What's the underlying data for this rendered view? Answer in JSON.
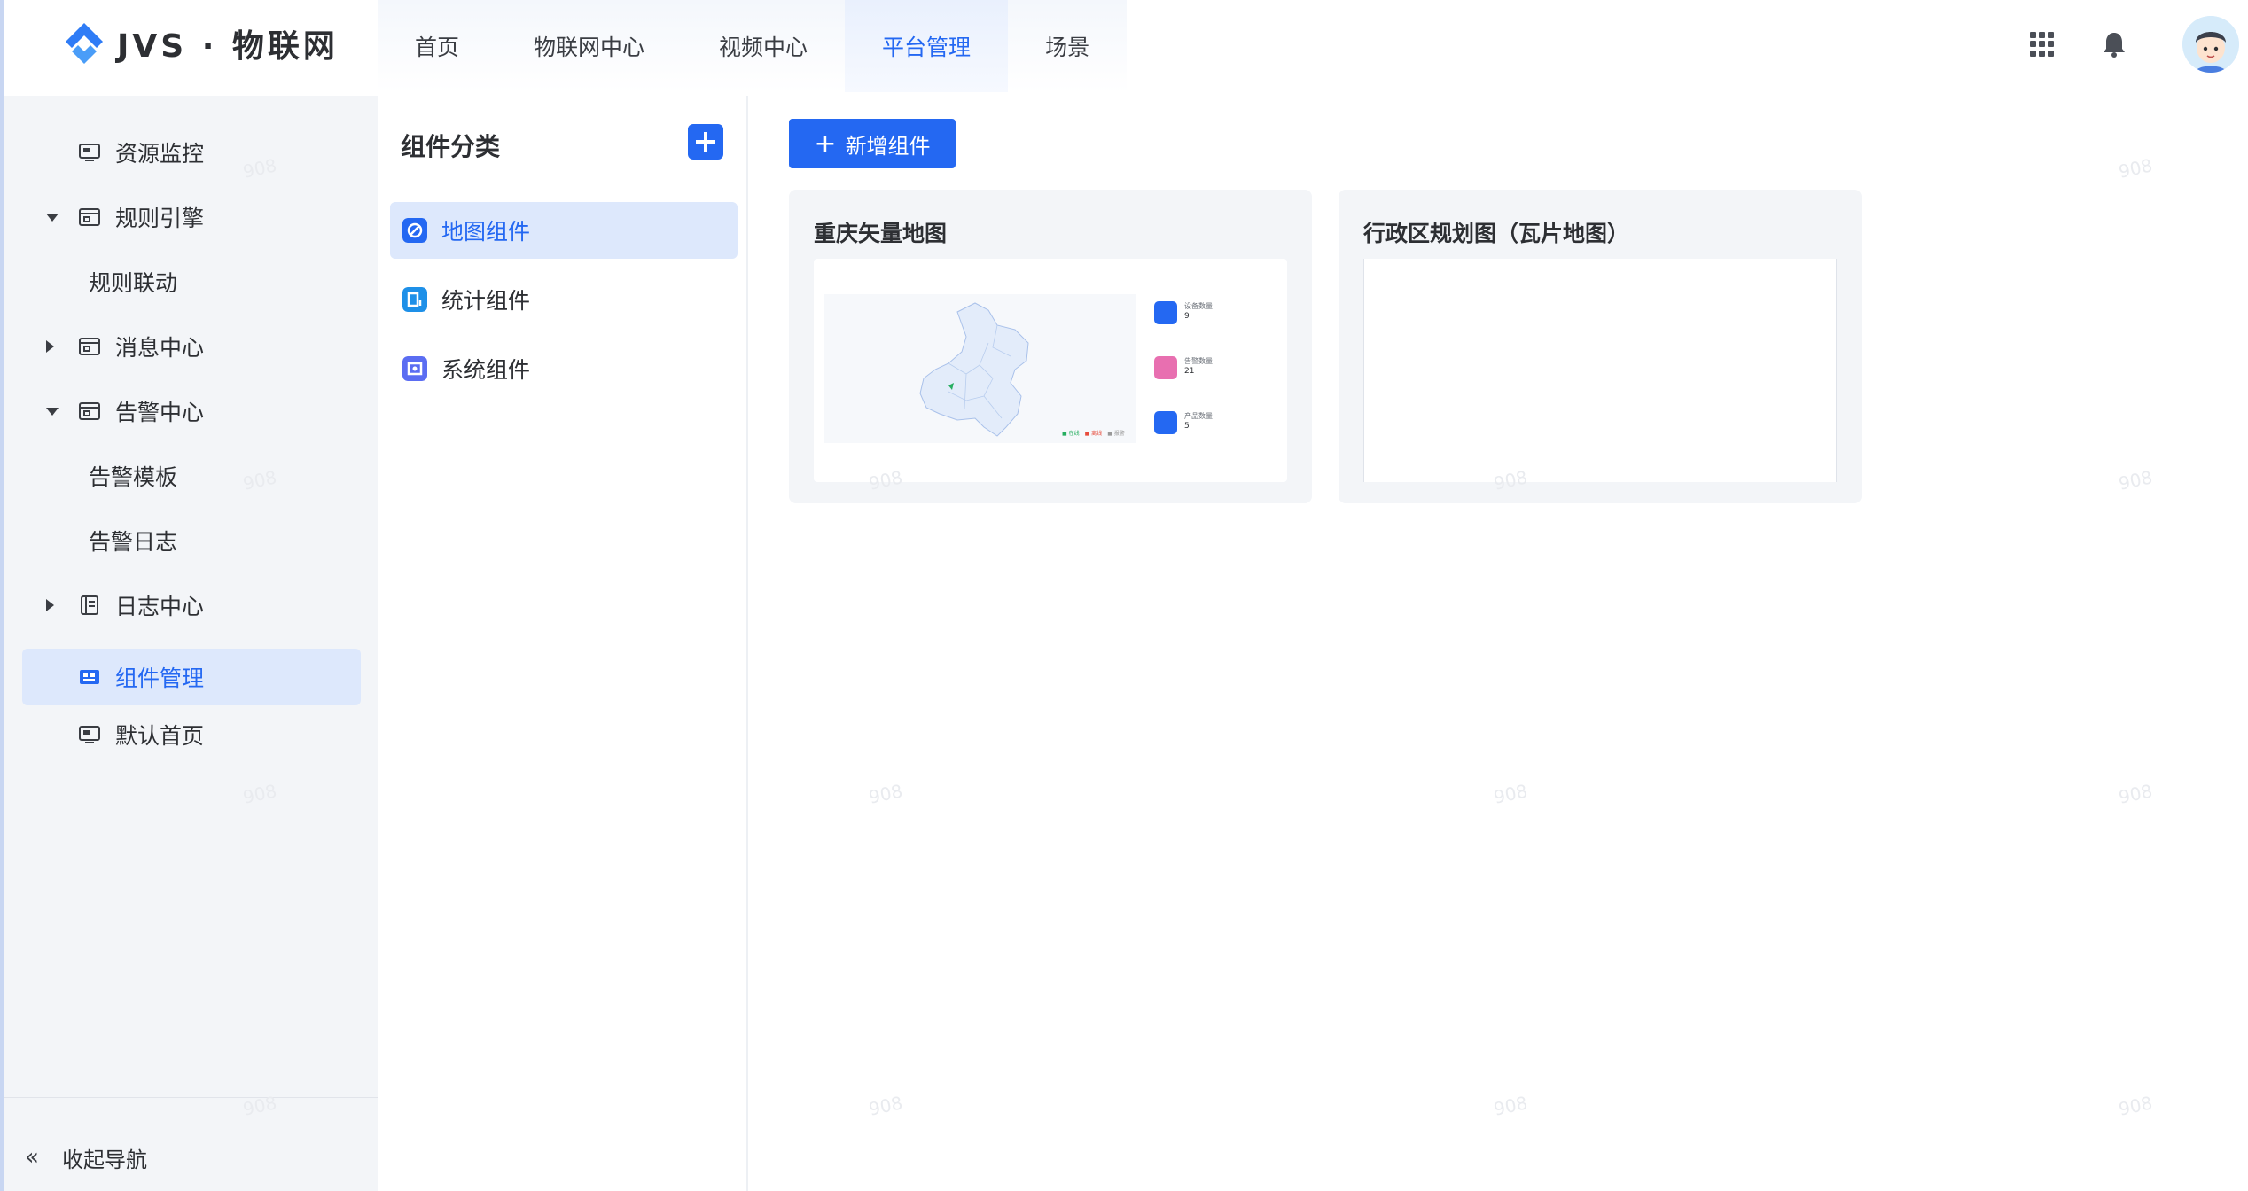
{
  "app": {
    "logo_text": "JVS · 物联网",
    "brand_color": "#2468f2"
  },
  "topnav": {
    "items": [
      {
        "label": "首页"
      },
      {
        "label": "物联网中心"
      },
      {
        "label": "视频中心"
      },
      {
        "label": "平台管理",
        "active": true
      },
      {
        "label": "场景"
      }
    ]
  },
  "header": {
    "icons": [
      "apps-grid-icon",
      "bell-icon",
      "user-avatar"
    ]
  },
  "sidebar": {
    "items": [
      {
        "label": "资源监控",
        "icon": "monitor-icon"
      },
      {
        "label": "规则引擎",
        "icon": "rule-icon",
        "expanded": true
      },
      {
        "label": "规则联动",
        "sub": true
      },
      {
        "label": "消息中心",
        "icon": "message-icon",
        "expanded": false
      },
      {
        "label": "告警中心",
        "icon": "alarm-icon",
        "expanded": true
      },
      {
        "label": "告警模板",
        "sub": true
      },
      {
        "label": "告警日志",
        "sub": true
      },
      {
        "label": "日志中心",
        "icon": "log-icon",
        "expanded": false
      },
      {
        "label": "组件管理",
        "icon": "component-icon",
        "active": true
      },
      {
        "label": "默认首页",
        "icon": "home-page-icon"
      }
    ],
    "collapse_label": "收起导航"
  },
  "category_panel": {
    "title": "组件分类",
    "items": [
      {
        "label": "地图组件",
        "active": true,
        "color": "#2468f2"
      },
      {
        "label": "统计组件",
        "color": "#1e90e8"
      },
      {
        "label": "系统组件",
        "color": "#5b6df2"
      }
    ]
  },
  "main": {
    "add_button_label": "新增组件",
    "cards": [
      {
        "title": "重庆矢量地图",
        "preview": {
          "stats": [
            {
              "title": "设备数量",
              "value": "9",
              "color": "#2468f2"
            },
            {
              "title": "告警数量",
              "value": "21",
              "color": "#e86fb0"
            },
            {
              "title": "产品数量",
              "value": "5",
              "color": "#2468f2"
            }
          ],
          "legend": [
            "在线",
            "离线",
            "报警"
          ]
        }
      },
      {
        "title": "行政区规划图（瓦片地图）"
      }
    ]
  },
  "watermark_text": "908"
}
